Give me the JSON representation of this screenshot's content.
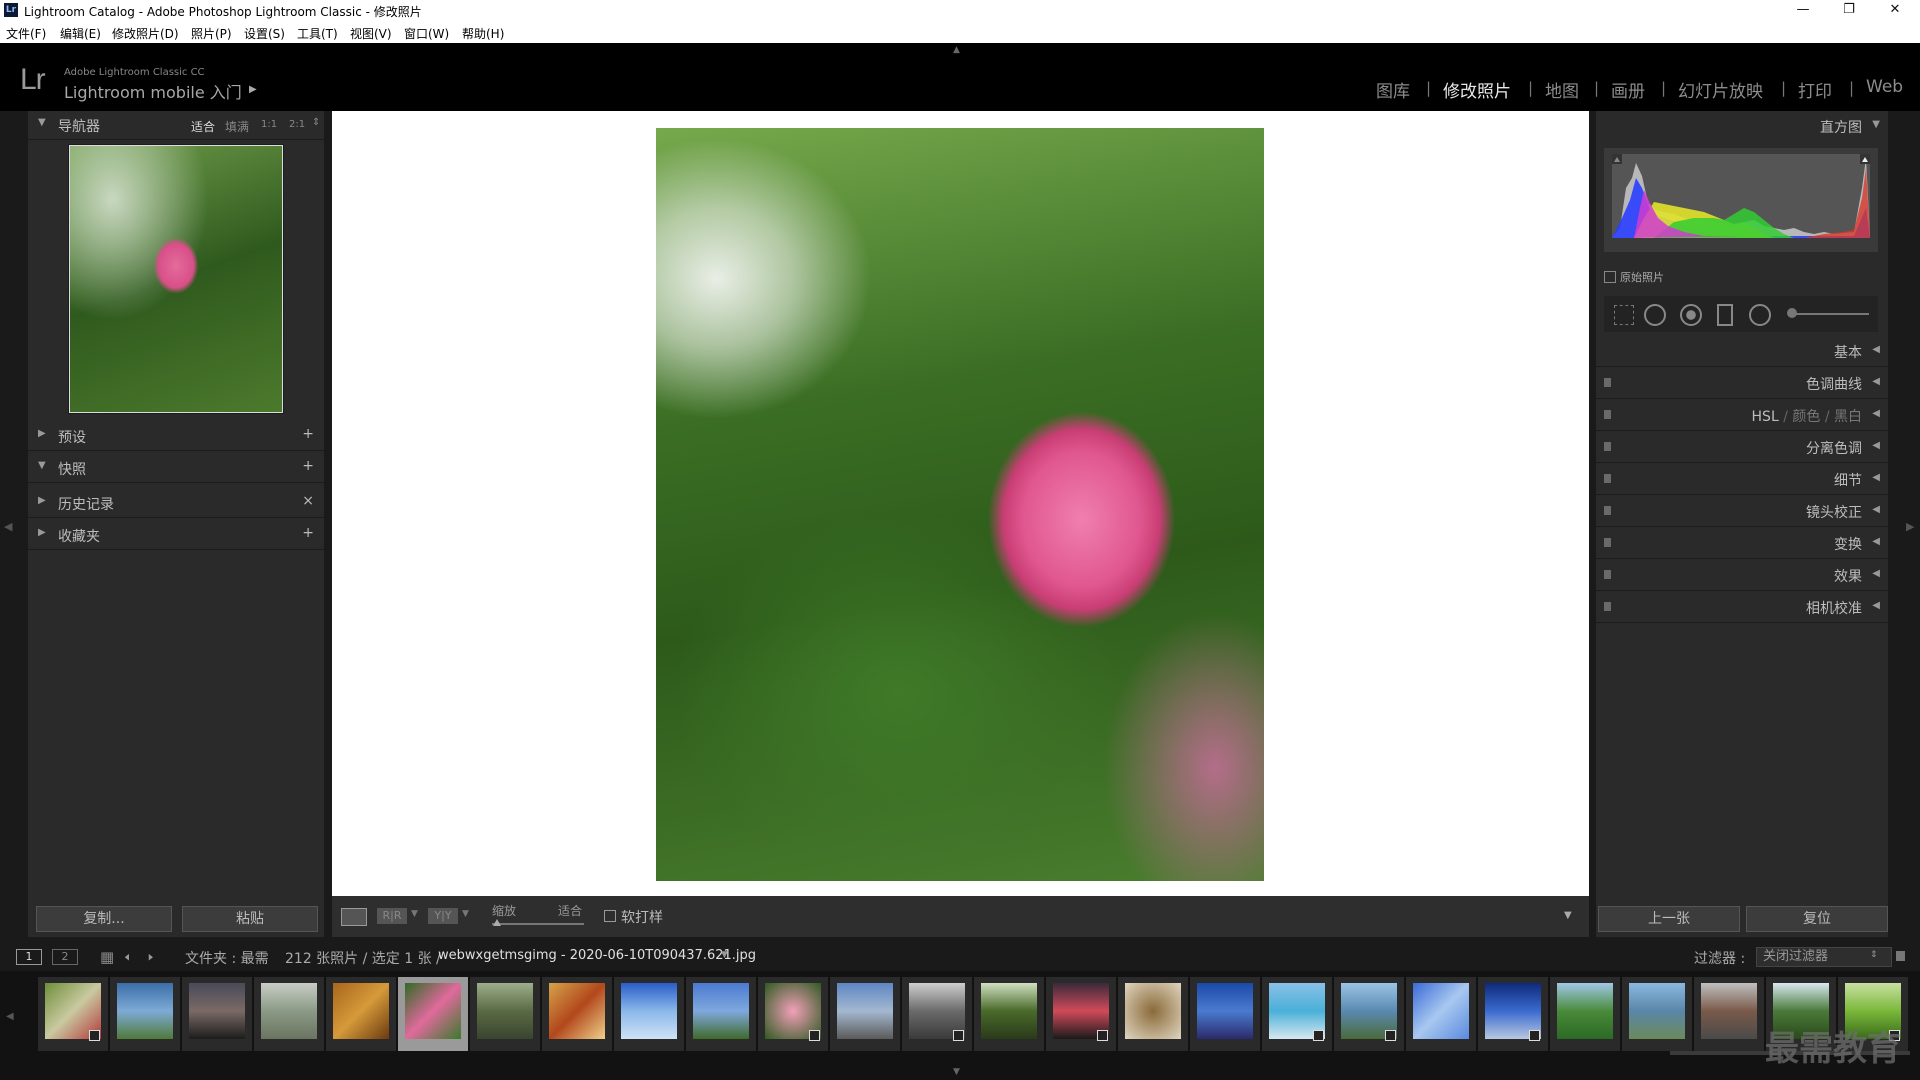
{
  "window": {
    "title": "Lightroom Catalog - Adobe Photoshop Lightroom Classic - 修改照片",
    "app_icon": "Lr",
    "controls": [
      "minimize-icon",
      "restore-icon",
      "close-icon"
    ]
  },
  "menu": [
    "文件(F)",
    "编辑(E)",
    "修改照片(D)",
    "照片(P)",
    "设置(S)",
    "工具(T)",
    "视图(V)",
    "窗口(W)",
    "帮助(H)"
  ],
  "identity": {
    "logo": "Lr",
    "small": "Adobe Lightroom Classic CC",
    "big": "Lightroom mobile 入门",
    "arrow": "▶"
  },
  "modules": [
    {
      "label": "图库",
      "active": false
    },
    {
      "label": "修改照片",
      "active": true
    },
    {
      "label": "地图",
      "active": false
    },
    {
      "label": "画册",
      "active": false
    },
    {
      "label": "幻灯片放映",
      "active": false
    },
    {
      "label": "打印",
      "active": false
    },
    {
      "label": "Web",
      "active": false
    }
  ],
  "navigator": {
    "title": "导航器",
    "zoom_options": [
      "适合",
      "填满",
      "1:1",
      "2:1"
    ],
    "zoom_more": "⇕"
  },
  "left_sections": [
    {
      "label": "预设",
      "expanded": false,
      "action": "+"
    },
    {
      "label": "快照",
      "expanded": true,
      "action": "+"
    },
    {
      "label": "历史记录",
      "expanded": false,
      "action": "×"
    },
    {
      "label": "收藏夹",
      "expanded": false,
      "action": "+"
    }
  ],
  "left_buttons": {
    "copy": "复制...",
    "paste": "粘贴"
  },
  "histogram": {
    "title": "直方图",
    "original_photo": "原始照片"
  },
  "right_sections": [
    {
      "label": "基本",
      "switch": false
    },
    {
      "label": "色调曲线",
      "switch": true
    },
    {
      "label": "HSL / 颜色 / 黑白",
      "switch": true
    },
    {
      "label": "分离色调",
      "switch": true
    },
    {
      "label": "细节",
      "switch": true
    },
    {
      "label": "镜头校正",
      "switch": true
    },
    {
      "label": "变换",
      "switch": true
    },
    {
      "label": "效果",
      "switch": true
    },
    {
      "label": "相机校准",
      "switch": true
    }
  ],
  "hsl": {
    "a": "HSL",
    "sep": "/",
    "b": "颜色",
    "c": "黑白"
  },
  "right_buttons": {
    "prev": "上一张",
    "reset": "复位"
  },
  "toolbar": {
    "zoom_label": "缩放",
    "zoom_value": "适合",
    "soft_proof": "软打样",
    "rr": "R|R",
    "yy": "Y|Y"
  },
  "filmbar": {
    "pages": [
      "1",
      "2"
    ],
    "source": "文件夹 : 最需",
    "count": "212 张照片 / 选定 1 张 /",
    "filename": "webwxgetmsgimg - 2020-06-10T090437.621.jpg",
    "filter_label": "过滤器 :",
    "filter_value": "关闭过滤器"
  },
  "watermark": "最需教育",
  "colors": {
    "panel": "#2a2a2a",
    "background": "#1a1a1a",
    "canvas": "#ffffff",
    "selected_thumb": "#9a9a9a"
  },
  "filmstrip": [
    {
      "name": "thumb-flower-white",
      "bg": "linear-gradient(135deg,#6e8f3a,#c9c9a0,#b23a3a)",
      "badge": true
    },
    {
      "name": "thumb-lake-sky",
      "bg": "linear-gradient(180deg,#3a6ea8,#7faad6,#4f7a3a)",
      "badge": false
    },
    {
      "name": "thumb-dusk",
      "bg": "linear-gradient(180deg,#4a4a58,#7a6a66,#1c1c1c)",
      "badge": false
    },
    {
      "name": "thumb-grey-trees",
      "bg": "linear-gradient(180deg,#c9cdc5,#8a9a86,#6b7460)",
      "badge": false
    },
    {
      "name": "thumb-autumn",
      "bg": "linear-gradient(135deg,#a8661c,#d69a3a,#6b3a10)",
      "badge": false
    },
    {
      "name": "thumb-pink-flower",
      "bg": "linear-gradient(135deg,#2f6b24,#e06a9c,#3b7a2c)",
      "badge": false,
      "selected": true
    },
    {
      "name": "thumb-path",
      "bg": "linear-gradient(180deg,#9cae8a,#5a6a44,#3a4430)",
      "badge": false
    },
    {
      "name": "thumb-food",
      "bg": "linear-gradient(135deg,#d6a24a,#b2481c,#f0d08a)",
      "badge": false
    },
    {
      "name": "thumb-blue-sky",
      "bg": "linear-gradient(180deg,#2a5ec8,#8ab8ea,#cfe2f6)",
      "badge": false
    },
    {
      "name": "thumb-blue-trees",
      "bg": "linear-gradient(180deg,#4a7ad0,#7fa8de,#3f6a2a)",
      "badge": false
    },
    {
      "name": "thumb-lotus",
      "bg": "radial-gradient(circle,#f2a0b8,#2f5a22)",
      "badge": true
    },
    {
      "name": "thumb-city",
      "bg": "linear-gradient(180deg,#5e86c4,#a4b8d0,#5a5a5a)",
      "badge": false
    },
    {
      "name": "thumb-street",
      "bg": "linear-gradient(180deg,#cfcfcf,#6a6a6a,#3a3a3a)",
      "badge": true
    },
    {
      "name": "thumb-tall-trees",
      "bg": "linear-gradient(180deg,#cfe0c0,#4a6a2a,#2a3a1a)",
      "badge": false
    },
    {
      "name": "thumb-red-sunset",
      "bg": "linear-gradient(180deg,#3a2a3a,#d04a5a,#1a1a1a)",
      "badge": true
    },
    {
      "name": "thumb-dish",
      "bg": "radial-gradient(circle,#8a6a3a,#e0d6c0)",
      "badge": false
    },
    {
      "name": "thumb-blue-tree",
      "bg": "linear-gradient(180deg,#1a4aa8,#4a7ad0,#2a2a6a)",
      "badge": false
    },
    {
      "name": "thumb-sea",
      "bg": "linear-gradient(180deg,#8ac0e8,#4ab0d8,#d6e8f0)",
      "badge": true
    },
    {
      "name": "thumb-river",
      "bg": "linear-gradient(180deg,#9ac4e6,#5a8ab0,#4a6a3a)",
      "badge": true
    },
    {
      "name": "thumb-contrail",
      "bg": "linear-gradient(135deg,#3a6ad8,#a8c8f0,#5a8ae0)",
      "badge": false
    },
    {
      "name": "thumb-deep-blue",
      "bg": "linear-gradient(180deg,#0e2a7a,#3a6ad0,#b8c8e0)",
      "badge": true
    },
    {
      "name": "thumb-field",
      "bg": "linear-gradient(180deg,#a0c8e8,#4a8a3a,#2a6a24)",
      "badge": false
    },
    {
      "name": "thumb-lake2",
      "bg": "linear-gradient(180deg,#8ab8e0,#5a86a8,#6a8a5a)",
      "badge": false
    },
    {
      "name": "thumb-houses",
      "bg": "linear-gradient(180deg,#c0c0c0,#7a5a4a,#4a4a4a)",
      "badge": false
    },
    {
      "name": "thumb-trees-bright",
      "bg": "linear-gradient(180deg,#d8e8f0,#4a7a3a,#2a4a1a)",
      "badge": false
    },
    {
      "name": "thumb-green-meadow",
      "bg": "linear-gradient(180deg,#c8e0a0,#7ab83a,#3a6a1a)",
      "badge": true
    }
  ]
}
